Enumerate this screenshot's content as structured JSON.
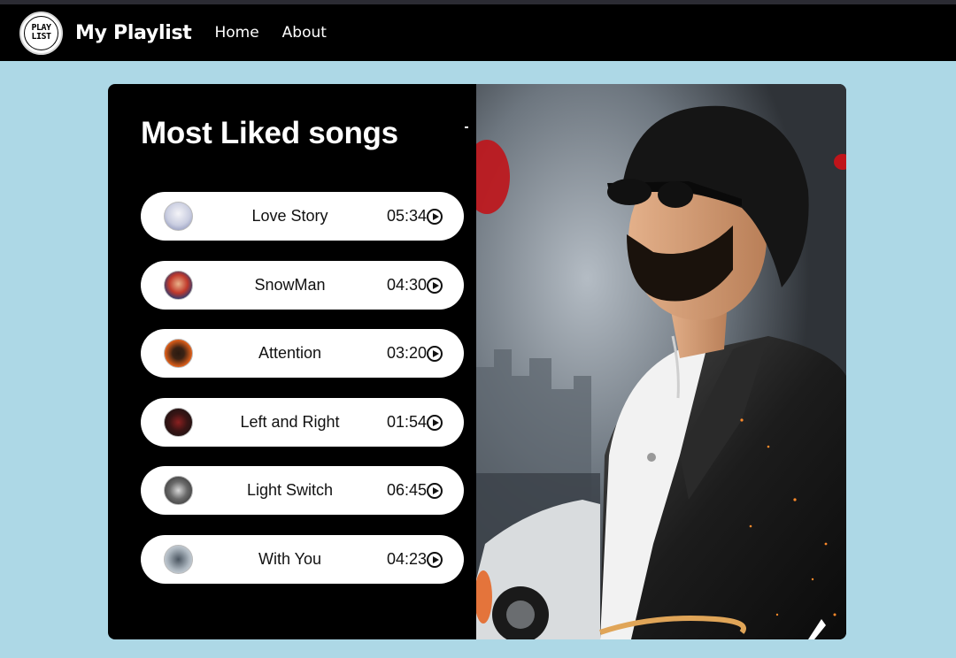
{
  "navbar": {
    "logo_top": "PLAY",
    "logo_bottom": "LIST",
    "brand": "My Playlist",
    "links": [
      "Home",
      "About"
    ]
  },
  "main": {
    "title": "Most Liked songs",
    "songs": [
      {
        "name": "Love Story",
        "duration": "05:34"
      },
      {
        "name": "SnowMan",
        "duration": "04:30"
      },
      {
        "name": "Attention",
        "duration": "03:20"
      },
      {
        "name": "Left and Right",
        "duration": "01:54"
      },
      {
        "name": "Light Switch",
        "duration": "06:45"
      },
      {
        "name": "With You",
        "duration": "04:23"
      }
    ]
  },
  "colors": {
    "page_background": "#add8e6",
    "navbar": "#000000",
    "card": "#000000",
    "song_pill": "#ffffff"
  },
  "icons": {
    "play": "play-circle-icon",
    "logo": "playlist-logo-icon"
  }
}
